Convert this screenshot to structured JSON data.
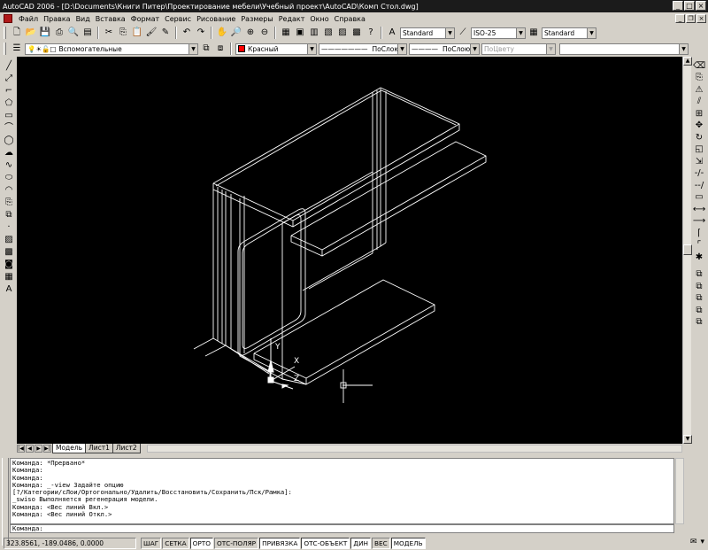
{
  "window": {
    "title": "AutoCAD 2006 - [D:\\Documents\\Книги Питер\\Проектирование мебели\\Учебный проект\\AutoCAD\\Комп Стол.dwg]",
    "min": "_",
    "max": "□",
    "close": "×"
  },
  "menu": [
    "Файл",
    "Правка",
    "Вид",
    "Вставка",
    "Формат",
    "Сервис",
    "Рисование",
    "Размеры",
    "Редакт",
    "Окно",
    "Справка"
  ],
  "toolbar1": {
    "text_style": "Standard",
    "dim_style": "ISO-25",
    "table_style": "Standard"
  },
  "toolbar2": {
    "layer": "Вспомогательные",
    "color": "Красный",
    "linetype": "ПоСлою",
    "lineweight": "ПоСлою",
    "plotstyle": "ПоЦвету",
    "colors": {
      "layer_color": "#ff0000"
    }
  },
  "viewport": {
    "ucs_y": "Y",
    "ucs_x": "X",
    "ucs_z": "Z",
    "background": "#000000",
    "line_color": "#ffffff"
  },
  "tabs": {
    "nav": [
      "|◀",
      "◀",
      "▶",
      "▶|"
    ],
    "items": [
      "Модель",
      "Лист1",
      "Лист2"
    ],
    "active": 0
  },
  "command": {
    "lines": [
      "Команда: *Прервано*",
      "Команда:",
      "Команда:",
      "Команда: _-view Задайте опцию",
      "[?/Категории/сЛои/Ортогонально/Удалить/Восстановить/Сохранить/Пск/Рамка]:",
      "_swiso Выполняется регенерация модели.",
      "Команда: <Вес линий Вкл.>",
      "Команда: <Вес линий Откл.>"
    ],
    "prompt": "Команда:"
  },
  "status": {
    "coords": "323.8561, -189.0486, 0.0000",
    "buttons": [
      {
        "label": "ШАГ",
        "on": false
      },
      {
        "label": "СЕТКА",
        "on": false
      },
      {
        "label": "ОРТО",
        "on": true
      },
      {
        "label": "ОТС-ПОЛЯР",
        "on": false
      },
      {
        "label": "ПРИВЯЗКА",
        "on": true
      },
      {
        "label": "ОТС-ОБЪЕКТ",
        "on": true
      },
      {
        "label": "ДИН",
        "on": true
      },
      {
        "label": "ВЕС",
        "on": false
      },
      {
        "label": "МОДЕЛЬ",
        "on": true
      }
    ]
  },
  "icons": {
    "left": [
      "line-icon",
      "xline-icon",
      "polyline-icon",
      "polygon-icon",
      "rectangle-icon",
      "arc-icon",
      "circle-icon",
      "revcloud-icon",
      "spline-icon",
      "ellipse-icon",
      "ellipse-arc-icon",
      "insert-block-icon",
      "make-block-icon",
      "point-icon",
      "hatch-icon",
      "gradient-icon",
      "region-icon",
      "table-icon",
      "mtext-icon"
    ],
    "right": [
      "erase-icon",
      "copy-icon",
      "mirror-icon",
      "offset-icon",
      "array-icon",
      "move-icon",
      "rotate-icon",
      "scale-icon",
      "stretch-icon",
      "trim-icon",
      "extend-icon",
      "break-at-point-icon",
      "break-icon",
      "join-icon",
      "chamfer-icon",
      "fillet-icon",
      "explode-icon"
    ]
  }
}
